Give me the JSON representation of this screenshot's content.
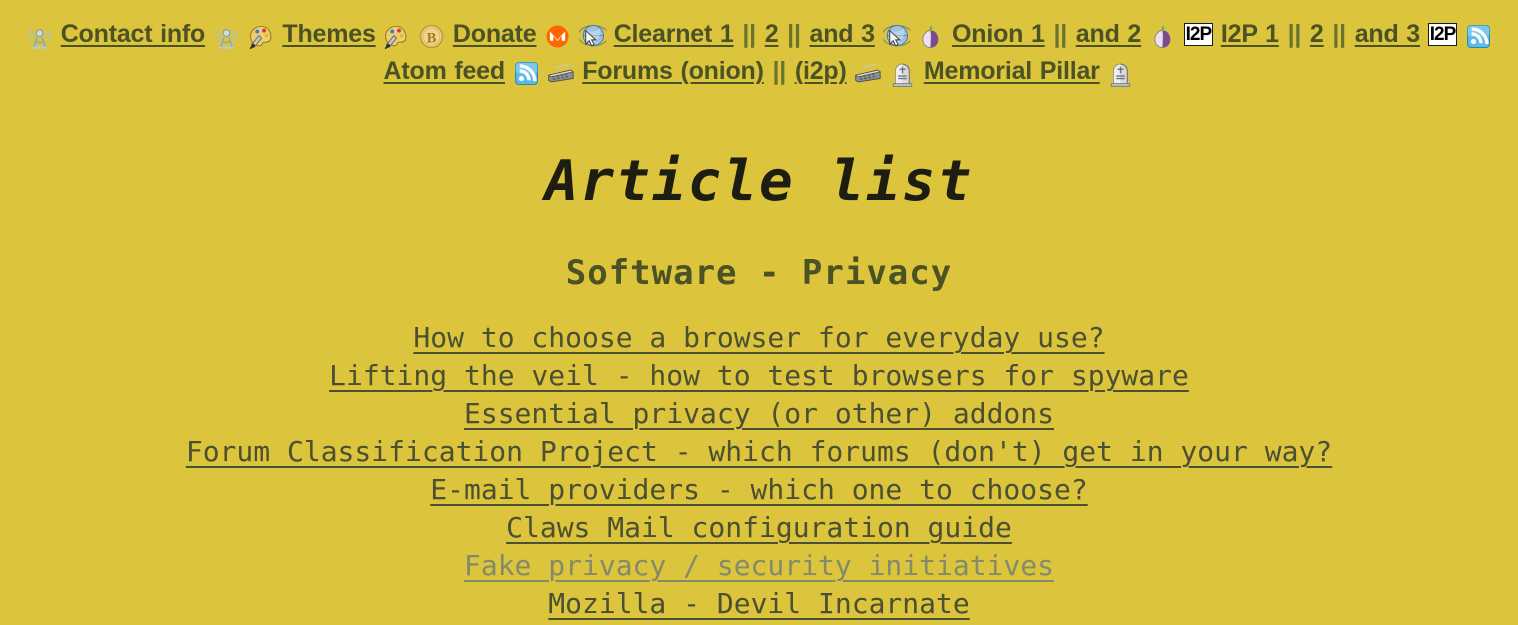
{
  "page": {
    "background_color": "#dcc43c",
    "link_color": "#4b5223",
    "visited_link_color": "#848b6b",
    "separator_color": "#68732f"
  },
  "nav": {
    "separator": "||",
    "items": [
      {
        "type": "icon",
        "name": "antenna-icon",
        "glyph": "antenna"
      },
      {
        "type": "link",
        "name": "contact-info-link",
        "label": "Contact info"
      },
      {
        "type": "icon",
        "name": "antenna-icon",
        "glyph": "antenna"
      },
      {
        "type": "icon",
        "name": "palette-icon",
        "glyph": "palette"
      },
      {
        "type": "link",
        "name": "themes-link",
        "label": "Themes"
      },
      {
        "type": "icon",
        "name": "palette-icon",
        "glyph": "palette"
      },
      {
        "type": "icon",
        "name": "bitcoin-icon",
        "glyph": "bitcoin"
      },
      {
        "type": "link",
        "name": "donate-link",
        "label": "Donate"
      },
      {
        "type": "icon",
        "name": "monero-icon",
        "glyph": "monero"
      },
      {
        "type": "icon",
        "name": "globe-cursor-icon",
        "glyph": "globe"
      },
      {
        "type": "link",
        "name": "clearnet-1-link",
        "label": "Clearnet 1"
      },
      {
        "type": "sep",
        "name": "nav-separator",
        "label": "||"
      },
      {
        "type": "link",
        "name": "clearnet-2-link",
        "label": "2"
      },
      {
        "type": "sep",
        "name": "nav-separator",
        "label": "||"
      },
      {
        "type": "link",
        "name": "clearnet-3-link",
        "label": "and 3"
      },
      {
        "type": "icon",
        "name": "globe-cursor-icon",
        "glyph": "globe"
      },
      {
        "type": "icon",
        "name": "onion-icon",
        "glyph": "onion"
      },
      {
        "type": "link",
        "name": "onion-1-link",
        "label": "Onion 1"
      },
      {
        "type": "sep",
        "name": "nav-separator",
        "label": "||"
      },
      {
        "type": "link",
        "name": "onion-2-link",
        "label": "and 2"
      },
      {
        "type": "icon",
        "name": "onion-icon",
        "glyph": "onion"
      },
      {
        "type": "badge",
        "name": "i2p-badge-icon",
        "label": "I2P"
      },
      {
        "type": "link",
        "name": "i2p-1-link",
        "label": "I2P 1"
      },
      {
        "type": "sep",
        "name": "nav-separator",
        "label": "||"
      },
      {
        "type": "link",
        "name": "i2p-2-link",
        "label": "2"
      },
      {
        "type": "sep",
        "name": "nav-separator",
        "label": "||"
      },
      {
        "type": "link",
        "name": "i2p-3-link",
        "label": "and 3"
      },
      {
        "type": "badge",
        "name": "i2p-badge-icon",
        "label": "I2P"
      },
      {
        "type": "icon",
        "name": "rss-icon",
        "glyph": "rss"
      },
      {
        "type": "link",
        "name": "atom-feed-link",
        "label": "Atom feed"
      },
      {
        "type": "icon",
        "name": "rss-icon",
        "glyph": "rss"
      },
      {
        "type": "icon",
        "name": "keyboard-icon",
        "glyph": "keyboard"
      },
      {
        "type": "link",
        "name": "forums-onion-link",
        "label": "Forums (onion)"
      },
      {
        "type": "sep",
        "name": "nav-separator",
        "label": "||"
      },
      {
        "type": "link",
        "name": "forums-i2p-link",
        "label": "(i2p)"
      },
      {
        "type": "icon",
        "name": "keyboard-icon",
        "glyph": "keyboard"
      },
      {
        "type": "icon",
        "name": "tombstone-icon",
        "glyph": "tombstone"
      },
      {
        "type": "link",
        "name": "memorial-pillar-link",
        "label": "Memorial Pillar"
      },
      {
        "type": "icon",
        "name": "tombstone-icon",
        "glyph": "tombstone"
      }
    ]
  },
  "heading": {
    "title": "Article list",
    "subtitle": "Software - Privacy"
  },
  "articles": [
    {
      "label": "How to choose a browser for everyday use?",
      "visited": false
    },
    {
      "label": "Lifting the veil - how to test browsers for spyware",
      "visited": false
    },
    {
      "label": "Essential privacy (or other) addons",
      "visited": false
    },
    {
      "label": "Forum Classification Project - which forums (don't) get in your way?",
      "visited": false
    },
    {
      "label": "E-mail providers - which one to choose?",
      "visited": false
    },
    {
      "label": "Claws Mail configuration guide",
      "visited": false
    },
    {
      "label": "Fake privacy / security initiatives",
      "visited": true
    },
    {
      "label": "Mozilla - Devil Incarnate",
      "visited": false
    }
  ]
}
